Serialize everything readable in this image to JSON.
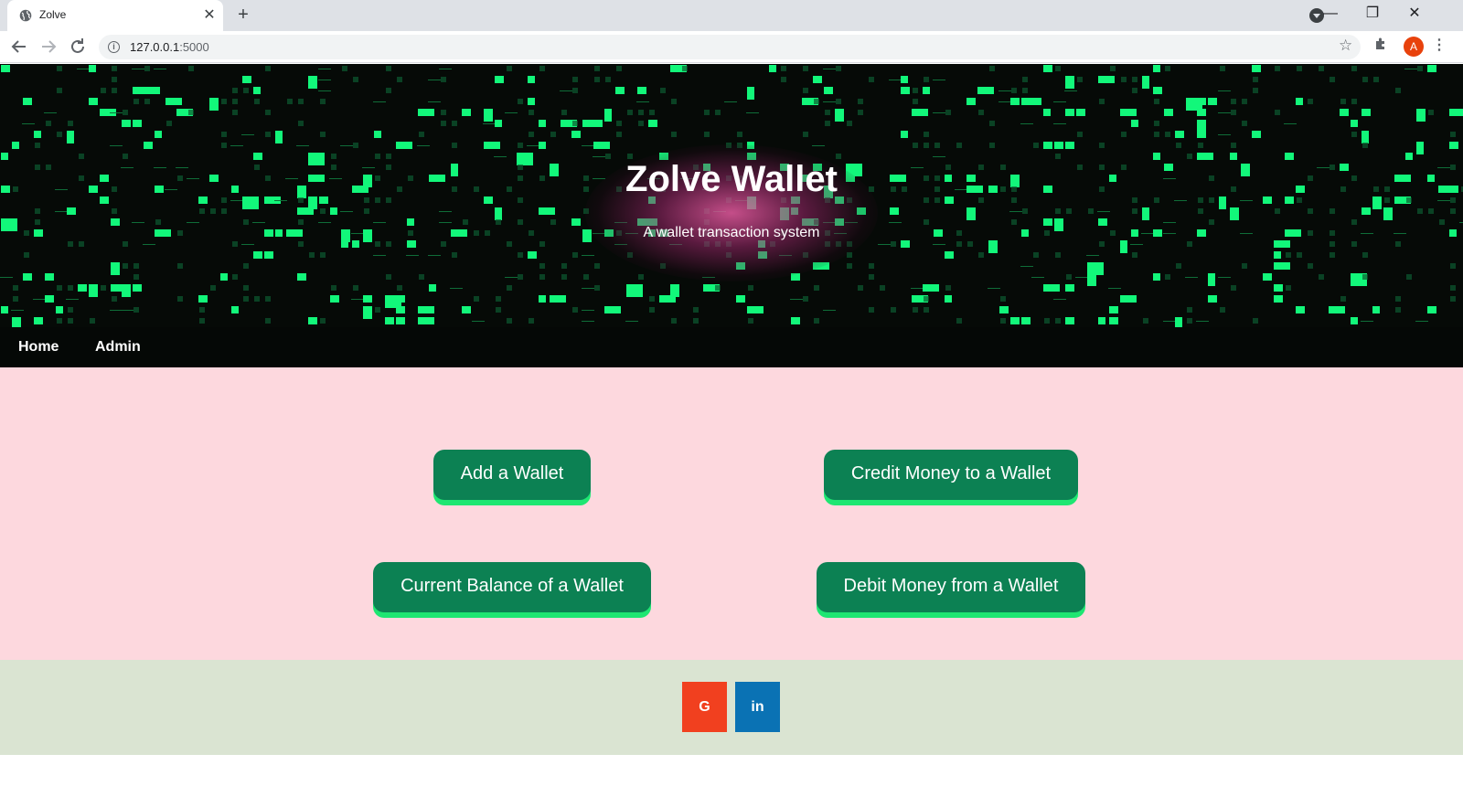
{
  "browser": {
    "tab_title": "Zolve",
    "tab_close": "✕",
    "new_tab": "+",
    "url_host": "127.0.0.1",
    "url_port": ":5000",
    "avatar_letter": "A",
    "window_controls": {
      "minimize": "—",
      "restore": "❐",
      "close": "✕"
    },
    "icons": [
      "globe-icon",
      "close-icon",
      "plus-icon",
      "tab-search-icon",
      "back-icon",
      "forward-icon",
      "reload-icon",
      "info-icon",
      "star-icon",
      "extensions-icon",
      "menu-icon"
    ]
  },
  "hero": {
    "title": "Zolve Wallet",
    "subtitle": "A wallet transaction system",
    "colors": {
      "background": "#060a07",
      "pixels": "#12f77a",
      "glow": "#e65aa0"
    }
  },
  "nav": {
    "items": [
      {
        "label": "Home"
      },
      {
        "label": "Admin"
      }
    ]
  },
  "actions": {
    "add_wallet": "Add a Wallet",
    "credit_money": "Credit Money to a Wallet",
    "current_balance": "Current Balance of a Wallet",
    "debit_money": "Debit Money from a Wallet",
    "colors": {
      "button": "#0c8153",
      "button_shadow": "#1ee672",
      "background": "#fdd8de"
    }
  },
  "footer": {
    "google_label": "G",
    "linkedin_label": "in",
    "colors": {
      "background": "#dae4d2",
      "google": "#f1401f",
      "linkedin": "#0a72b4"
    }
  }
}
